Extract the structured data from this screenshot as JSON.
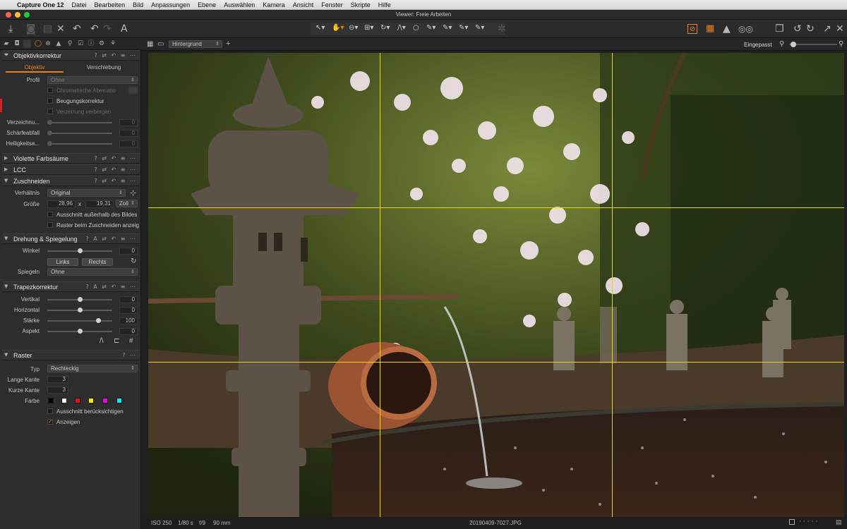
{
  "menubar": {
    "app": "Capture One 12",
    "items": [
      "Datei",
      "Bearbeiten",
      "Bild",
      "Anpassungen",
      "Ebene",
      "Auswählen",
      "Kamera",
      "Ansicht",
      "Fenster",
      "Skripte",
      "Hilfe"
    ]
  },
  "window": {
    "title": "Viewer: Freie Arbeiten"
  },
  "viewer": {
    "variant_select": "Hintergrund",
    "zoom_label": "Eingepasst"
  },
  "lens": {
    "title": "Objektivkorrektur",
    "tab_active": "Objektiv",
    "tab_other": "Verschiebung",
    "profile_label": "Profil",
    "profile_value": "Ohne",
    "chromatic": "Chromatische Aberratio",
    "diffraction": "Beugungskorrektur",
    "hide_distortion": "Verzerrung verbergen",
    "distortion": "Verzeichnu...",
    "sharpness": "Schärfeabfall",
    "brightness": "Helligkeitsa...",
    "distortion_val": "0",
    "sharpness_val": "0",
    "brightness_val": "0"
  },
  "fringe": {
    "title": "Violette Farbsäume"
  },
  "lcc": {
    "title": "LCC"
  },
  "crop": {
    "title": "Zuschneiden",
    "ratio_label": "Verhältnis",
    "ratio_value": "Original",
    "size_label": "Größe",
    "width": "28,96",
    "x": "x",
    "height": "19,31",
    "unit": "Zoll",
    "outside": "Ausschnitt außerhalb des Bildes",
    "grid_when_crop": "Raster beim Zuschneiden anzeigen"
  },
  "rotation": {
    "title": "Drehung & Spiegelung",
    "angle_label": "Winkel",
    "angle_val": "0",
    "left": "Links",
    "right": "Rechts",
    "flip_label": "Spiegeln",
    "flip_value": "Ohne"
  },
  "keystone": {
    "title": "Trapezkorrektur",
    "vertical": "Vertikal",
    "horizontal": "Horizontal",
    "strength": "Stärke",
    "aspect": "Aspekt",
    "vertical_val": "0",
    "horizontal_val": "0",
    "strength_val": "100",
    "aspect_val": "0"
  },
  "grid": {
    "title": "Raster",
    "type_label": "Typ",
    "type_value": "Rechteckig",
    "long_label": "Lange Kante",
    "long_val": "3",
    "short_label": "Kurze Kante",
    "short_val": "3",
    "color_label": "Farbe",
    "colors": [
      "#000000",
      "#ffffff",
      "#e01010",
      "#f0f000",
      "#e010e0",
      "#10f0f0"
    ],
    "respect_crop": "Ausschnitt berücksichtigen",
    "show": "Anzeigen"
  },
  "status": {
    "iso": "ISO 250",
    "shutter": "1/80 s",
    "aperture": "f/9",
    "focal": "90 mm",
    "filename": "20190409-7027.JPG"
  }
}
